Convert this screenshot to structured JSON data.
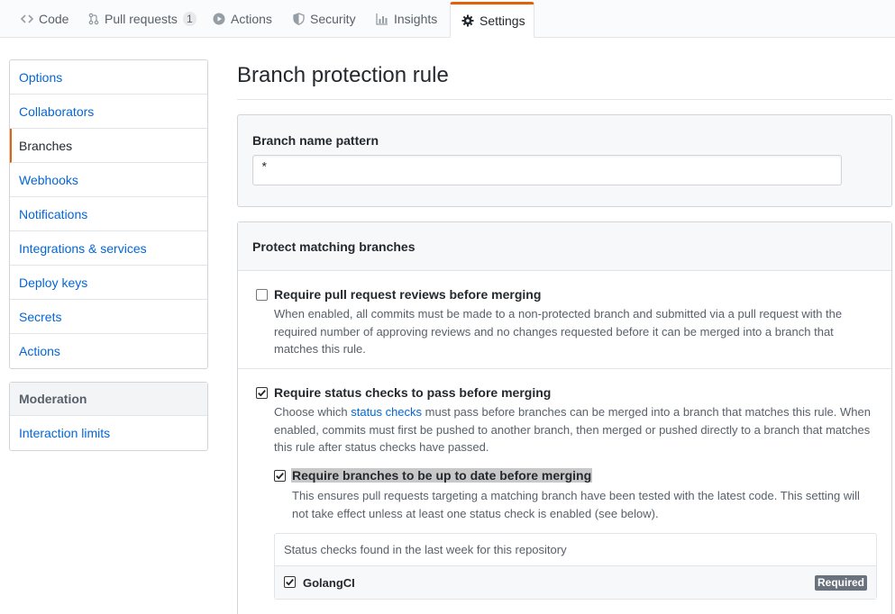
{
  "tabs": [
    {
      "label": "Code",
      "icon": "code-icon"
    },
    {
      "label": "Pull requests",
      "icon": "pull-request-icon",
      "count": "1"
    },
    {
      "label": "Actions",
      "icon": "play-icon"
    },
    {
      "label": "Security",
      "icon": "shield-icon"
    },
    {
      "label": "Insights",
      "icon": "graph-icon"
    },
    {
      "label": "Settings",
      "icon": "gear-icon",
      "selected": true
    }
  ],
  "sidebar": {
    "items": [
      {
        "label": "Options"
      },
      {
        "label": "Collaborators"
      },
      {
        "label": "Branches",
        "selected": true
      },
      {
        "label": "Webhooks"
      },
      {
        "label": "Notifications"
      },
      {
        "label": "Integrations & services"
      },
      {
        "label": "Deploy keys"
      },
      {
        "label": "Secrets"
      },
      {
        "label": "Actions"
      }
    ],
    "moderation": {
      "heading": "Moderation",
      "items": [
        {
          "label": "Interaction limits"
        }
      ]
    }
  },
  "main": {
    "title": "Branch protection rule",
    "pattern": {
      "label": "Branch name pattern",
      "value": "*"
    },
    "protect": {
      "heading": "Protect matching branches",
      "reviews": {
        "label": "Require pull request reviews before merging",
        "checked": false,
        "note": "When enabled, all commits must be made to a non-protected branch and submitted via a pull request with the required number of approving reviews and no changes requested before it can be merged into a branch that matches this rule."
      },
      "status": {
        "label": "Require status checks to pass before merging",
        "checked": true,
        "note_prefix": "Choose which ",
        "note_link": "status checks",
        "note_suffix": " must pass before branches can be merged into a branch that matches this rule. When enabled, commits must first be pushed to another branch, then merged or pushed directly to a branch that matches this rule after status checks have passed."
      },
      "uptodate": {
        "label": "Require branches to be up to date before merging",
        "checked": true,
        "note": "This ensures pull requests targeting a matching branch have been tested with the latest code. This setting will not take effect unless at least one status check is enabled (see below)."
      },
      "checks": {
        "heading": "Status checks found in the last week for this repository",
        "items": [
          {
            "name": "GolangCI",
            "checked": true,
            "badge": "Required"
          }
        ]
      }
    }
  },
  "colors": {
    "accent": "#e36209",
    "link": "#0366d6",
    "muted": "#586069",
    "border": "#d1d5da",
    "badge": "#6a737d"
  }
}
